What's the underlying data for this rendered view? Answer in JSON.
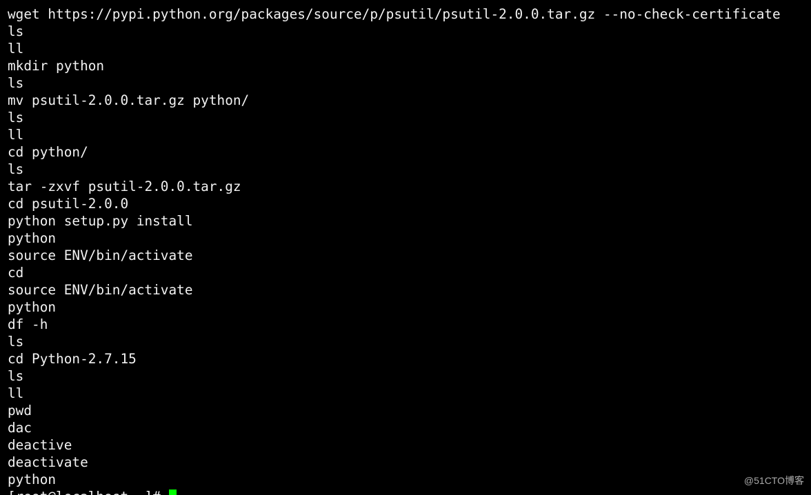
{
  "terminal": {
    "background": "#000000",
    "text_color": "#f2f2f2",
    "cursor_color": "#00ff00",
    "lines": [
      "wget https://pypi.python.org/packages/source/p/psutil/psutil-2.0.0.tar.gz --no-check-certificate",
      "ls",
      "ll",
      "mkdir python",
      "ls",
      "mv psutil-2.0.0.tar.gz python/",
      "ls",
      "ll",
      "cd python/",
      "ls",
      "tar -zxvf psutil-2.0.0.tar.gz",
      "cd psutil-2.0.0",
      "python setup.py install",
      "python",
      "source ENV/bin/activate",
      "cd",
      "source ENV/bin/activate",
      "python",
      "df -h",
      "ls",
      "cd Python-2.7.15",
      "ls",
      "ll",
      "pwd",
      "dac",
      "deactive",
      "deactivate",
      "python"
    ],
    "prompt": "[root@localhost ~]#"
  },
  "watermark": {
    "text": "@51CTO博客"
  }
}
